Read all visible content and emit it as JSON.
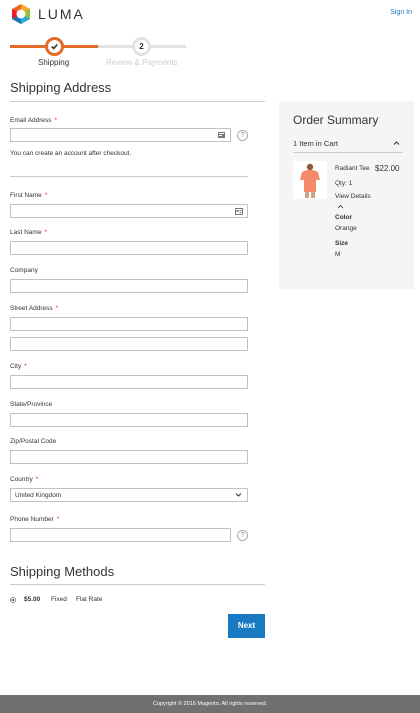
{
  "header": {
    "logo_text": "LUMA",
    "sign_in": "Sign In"
  },
  "progress": {
    "step1_label": "Shipping",
    "step2_number": "2",
    "step2_label": "Review & Payments"
  },
  "shipping_address": {
    "title": "Shipping Address",
    "email_label": "Email Address",
    "email_note": "You can create an account after checkout.",
    "first_name_label": "First Name",
    "last_name_label": "Last Name",
    "company_label": "Company",
    "street_label": "Street Address",
    "city_label": "City",
    "state_label": "State/Province",
    "zip_label": "Zip/Postal Code",
    "country_label": "Country",
    "country_value": "United Kingdom",
    "phone_label": "Phone Number",
    "required_mark": "*",
    "help_glyph": "?"
  },
  "shipping_methods": {
    "title": "Shipping Methods",
    "price": "$5.00",
    "carrier": "Fixed",
    "method": "Flat Rate",
    "next_button": "Next"
  },
  "order_summary": {
    "title": "Order Summary",
    "items_in_cart": "1 Item in Cart",
    "product_name": "Radiant Tee",
    "product_price": "$22.00",
    "qty": "Qty: 1",
    "view_details": "View Details",
    "color_label": "Color",
    "color_value": "Orange",
    "size_label": "Size",
    "size_value": "M"
  },
  "footer": {
    "copyright": "Copyright © 2016 Magento. All rights reserved."
  },
  "colors": {
    "accent_orange": "#e06c2a",
    "primary_blue": "#1979c3",
    "required_red": "#e02b27",
    "footer_gray": "#6e716e"
  }
}
